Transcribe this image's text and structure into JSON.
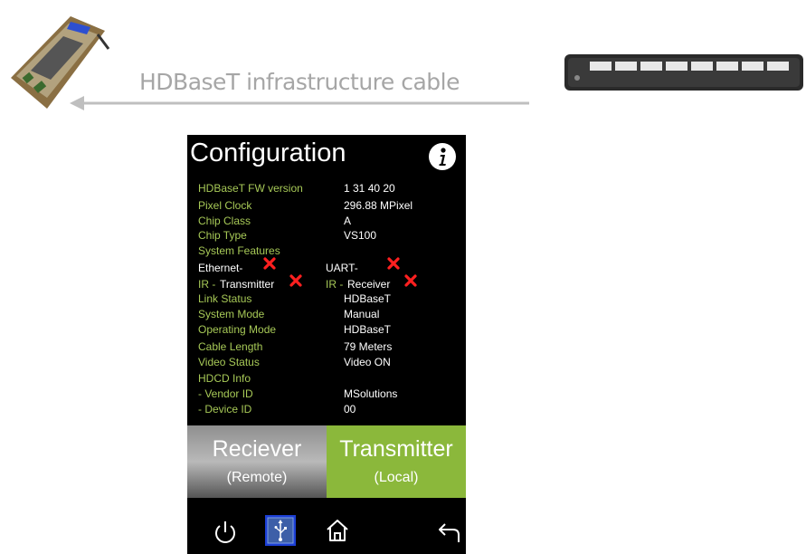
{
  "cable_label": "HDBaseT infrastructure cable",
  "screen": {
    "title": "Configuration",
    "rows": [
      {
        "label": "HDBaseT FW version",
        "value": "1    31   40   20"
      },
      {
        "label": "Pixel Clock",
        "value": "296.88    MPixel"
      },
      {
        "label": "Chip Class",
        "value": "A"
      },
      {
        "label": "Chip Type",
        "value": "VS100"
      },
      {
        "label": "System Features",
        "value": ""
      }
    ],
    "features": {
      "ethernet": "Ethernet-",
      "uart": "UART-",
      "ir_prefix": "IR -",
      "transmitter": "Transmitter",
      "receiver": "Receiver"
    },
    "rows2": [
      {
        "label": "Link Status",
        "value": "HDBaseT"
      },
      {
        "label": "System Mode",
        "value": "Manual"
      },
      {
        "label": "Operating Mode",
        "value": "HDBaseT"
      },
      {
        "label": "Cable Length",
        "value": "79 Meters"
      },
      {
        "label": "Video Status",
        "value": "Video ON"
      },
      {
        "label": "HDCD Info",
        "value": ""
      },
      {
        "label": "- Vendor ID",
        "value": "MSolutions"
      },
      {
        "label": "- Device ID",
        "value": "00"
      }
    ],
    "tabs": {
      "receiver_main": "Reciever",
      "receiver_sub": "(Remote)",
      "transmitter_main": "Transmitter",
      "transmitter_sub": "(Local)"
    },
    "icons": [
      "power-icon",
      "usb-icon",
      "home-icon",
      "back-icon"
    ]
  },
  "colors": {
    "label_green": "#a7c957",
    "transmitter_green": "#8bb83b",
    "x_red": "#ff2020",
    "arrow_gray": "#bfbfbf"
  }
}
